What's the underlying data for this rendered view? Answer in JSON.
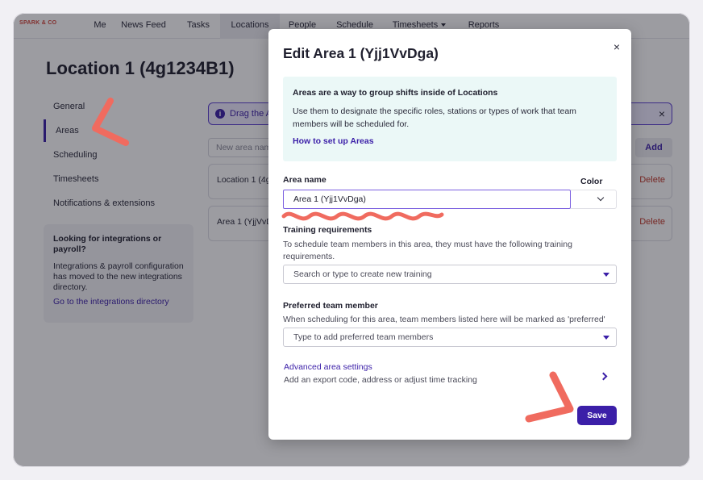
{
  "brand": "SPARK & CO",
  "nav": {
    "items": [
      "Me",
      "News Feed",
      "Tasks",
      "Locations",
      "People",
      "Schedule",
      "Timesheets",
      "Reports"
    ],
    "active": "Locations"
  },
  "page": {
    "title": "Location 1 (4g1234B1)"
  },
  "sidebar": {
    "items": [
      "General",
      "Areas",
      "Scheduling",
      "Timesheets",
      "Notifications & extensions"
    ],
    "active": "Areas",
    "card": {
      "title": "Looking for integrations or payroll?",
      "body": "Integrations & payroll configuration has moved to the new integrations directory.",
      "link": "Go to the integrations directory"
    }
  },
  "main": {
    "banner_text": "Drag the A",
    "area_input_placeholder": "New area nam",
    "add_label": "Add",
    "rows": [
      {
        "name": "Location 1 (4g",
        "delete_label": "Delete"
      },
      {
        "name": "Area 1 (YjjVvD",
        "delete_label": "Delete"
      }
    ]
  },
  "modal": {
    "title": "Edit Area 1 (Yjj1VvDga)",
    "close_symbol": "×",
    "callout": {
      "title": "Areas are a way to group shifts inside of Locations",
      "body": "Use them to designate the specific roles, stations or types of work that team members will be scheduled for.",
      "link": "How to set up Areas"
    },
    "area_name_label": "Area name",
    "area_name_value": "Area 1 (Yjj1VvDga)",
    "color_label": "Color",
    "training_label": "Training requirements",
    "training_help": "To schedule team members in this area, they must have the following training requirements.",
    "training_placeholder": "Search or type to create new training",
    "preferred_label": "Preferred team member",
    "preferred_help": "When scheduling for this area, team members listed here will be marked as 'preferred'",
    "preferred_placeholder": "Type to add preferred team members",
    "advanced_link": "Advanced area settings",
    "advanced_sub": "Add an export code, address or adjust time tracking",
    "save_label": "Save"
  },
  "colors": {
    "accent": "#3b1fa8",
    "annotation": "#f06b5f",
    "callout_bg": "#ebf8f7"
  }
}
